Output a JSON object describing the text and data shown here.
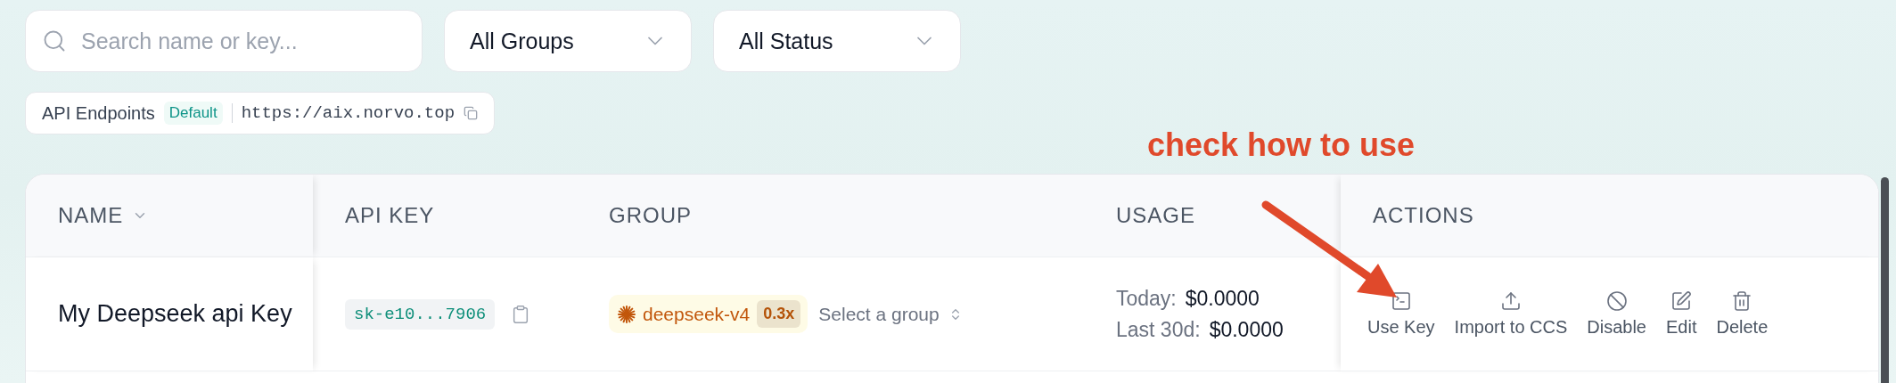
{
  "filters": {
    "search": {
      "placeholder": "Search name or key..."
    },
    "dropdowns": [
      {
        "value": "All Groups"
      },
      {
        "value": "All Status"
      }
    ]
  },
  "endpoint": {
    "label": "API Endpoints",
    "badge": "Default",
    "url": "https://aix.norvo.top"
  },
  "annotation": {
    "text": "check how to use"
  },
  "table": {
    "columns": [
      {
        "label": "NAME",
        "sortable": true
      },
      {
        "label": "API KEY",
        "sortable": false
      },
      {
        "label": "GROUP",
        "sortable": false
      },
      {
        "label": "USAGE",
        "sortable": false
      },
      {
        "label": "ACTIONS",
        "sortable": false
      }
    ],
    "rows": [
      {
        "name": "My Deepseek api Key",
        "key": "sk-e10...7906",
        "group": {
          "name": "deepseek-v4",
          "rate": "0.3x"
        },
        "group_select": "Select a group",
        "usage": [
          {
            "label": "Today:",
            "value": "$0.0000"
          },
          {
            "label": "Last 30d:",
            "value": "$0.0000"
          }
        ],
        "actions": [
          {
            "kind": "terminal",
            "label": "Use Key"
          },
          {
            "kind": "upload",
            "label": "Import to CCS"
          },
          {
            "kind": "ban",
            "label": "Disable"
          },
          {
            "kind": "edit",
            "label": "Edit"
          },
          {
            "kind": "delete",
            "label": "Delete"
          }
        ]
      }
    ]
  }
}
